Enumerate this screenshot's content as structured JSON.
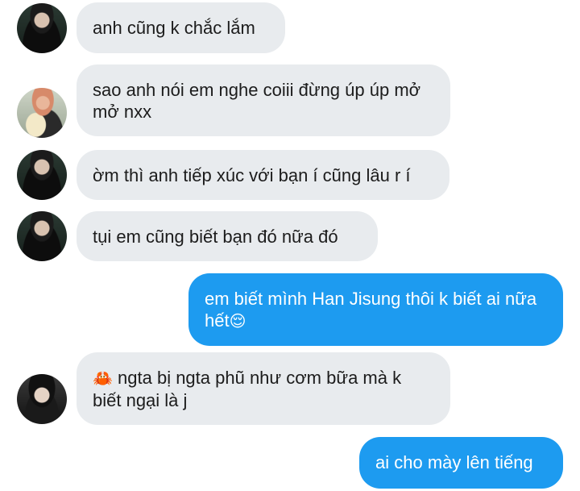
{
  "messages": [
    {
      "sender": "other",
      "avatar_icon": "suit-portrait-avatar",
      "text": "anh cũng k chắc lắm"
    },
    {
      "sender": "other",
      "avatar_icon": "flowers-portrait-avatar",
      "text": "sao anh nói em nghe coiii đừng úp úp mở mở nxx"
    },
    {
      "sender": "other",
      "avatar_icon": "suit-portrait-avatar",
      "text": "ờm thì anh tiếp xúc với bạn í cũng lâu r í"
    },
    {
      "sender": "other",
      "avatar_icon": "suit-portrait-avatar",
      "text": "tụi em cũng biết bạn đó nữa đó"
    },
    {
      "sender": "me",
      "text": "em biết mình Han Jisung thôi k biết ai nữa hết",
      "emoji": "😌"
    },
    {
      "sender": "other",
      "avatar_icon": "hat-portrait-avatar",
      "emoji": "🦀",
      "text": "ngta bị ngta phũ như cơm bữa mà k biết ngại là j"
    },
    {
      "sender": "me",
      "text": "ai cho mày lên tiếng"
    }
  ],
  "colors": {
    "incoming_bubble": "#e8ebee",
    "outgoing_bubble": "#1d9bf0"
  }
}
